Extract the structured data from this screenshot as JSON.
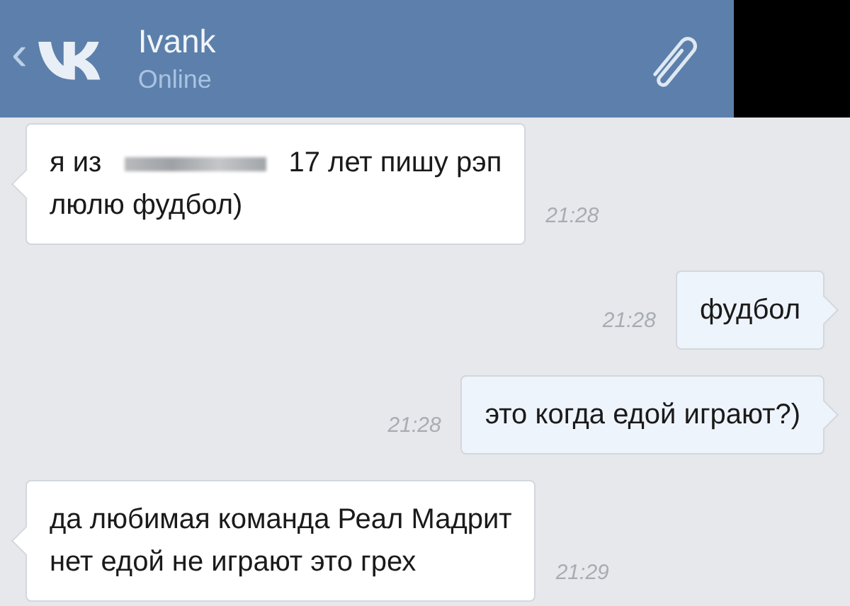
{
  "header": {
    "back": "‹",
    "name": "Ivank",
    "status": "Online"
  },
  "messages": [
    {
      "kind": "incoming",
      "redacted": true,
      "lines": [
        "я из",
        "17 лет пишу рэп",
        "люлю фудбол)"
      ],
      "time": "21:28"
    },
    {
      "kind": "outgoing",
      "redacted": false,
      "lines": [
        "фудбол"
      ],
      "time": "21:28"
    },
    {
      "kind": "outgoing",
      "redacted": false,
      "lines": [
        "это когда едой играют?)"
      ],
      "time": "21:28"
    },
    {
      "kind": "incoming",
      "redacted": false,
      "lines": [
        "да любимая команда Реал Мадрит",
        "нет едой не играют это грех"
      ],
      "time": "21:29"
    }
  ]
}
